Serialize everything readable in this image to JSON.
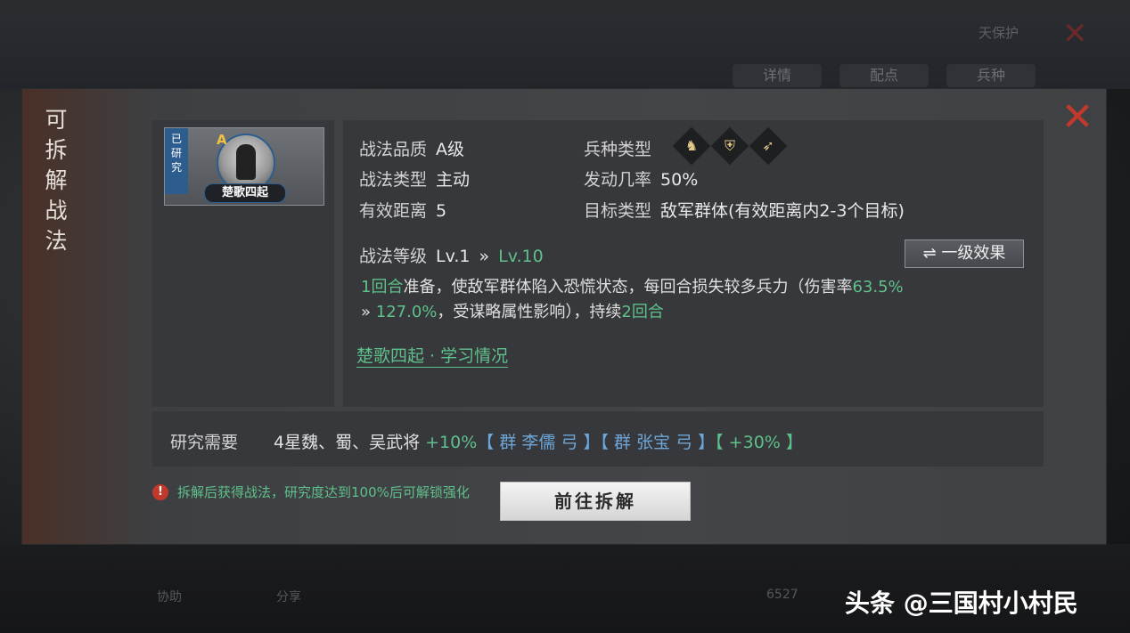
{
  "background": {
    "top_label": "天保护",
    "tabs": [
      "详情",
      "配点",
      "兵种"
    ],
    "bottom_labels": [
      "协助",
      "分享",
      "6527"
    ]
  },
  "modal": {
    "side_title": [
      "可",
      "拆",
      "解",
      "战",
      "法"
    ],
    "close_icon": "close-icon",
    "skill_card": {
      "researched_tag": [
        "已",
        "研",
        "究"
      ],
      "grade": "A",
      "name": "楚歌四起"
    },
    "info": {
      "quality_label": "战法品质",
      "quality_value": "A级",
      "troop_label": "兵种类型",
      "troop_icons": [
        "cavalry-icon",
        "shield-icon",
        "bow-icon"
      ],
      "type_label": "战法类型",
      "type_value": "主动",
      "rate_label": "发动几率",
      "rate_value": "50%",
      "range_label": "有效距离",
      "range_value": "5",
      "target_label": "目标类型",
      "target_value": "敌军群体(有效距离内2-3个目标)",
      "level_label": "战法等级",
      "level_from": "Lv.1",
      "level_arrow": "»",
      "level_to": "Lv.10",
      "effect_button": "一级效果"
    },
    "description": {
      "p1": "1回合",
      "p2": "准备，使敌军群体陷入恐慌状态，每回合损失较多兵力（伤害率",
      "p3": "63.5%",
      "p4": "»",
      "p5": "127.0%",
      "p6": "，受谋略属性影响），持续",
      "p7": "2回合"
    },
    "learn_link": "楚歌四起 · 学习情况",
    "requirement": {
      "label": "研究需要",
      "text": "4星魏、蜀、吴武将",
      "bonus1": "+10%",
      "bracket1": "【 群 李儒 弓 】",
      "bracket2": "【 群 张宝 弓 】",
      "bonus2": "【 +30% 】"
    },
    "warning": "拆解后获得战法，研究度达到100%后可解锁强化",
    "go_button": "前往拆解"
  },
  "watermark": "头条 @三国村小村民",
  "colors": {
    "accent_green": "#5fc08a",
    "accent_blue": "#6fa6d8",
    "close_red": "#c0392b"
  }
}
